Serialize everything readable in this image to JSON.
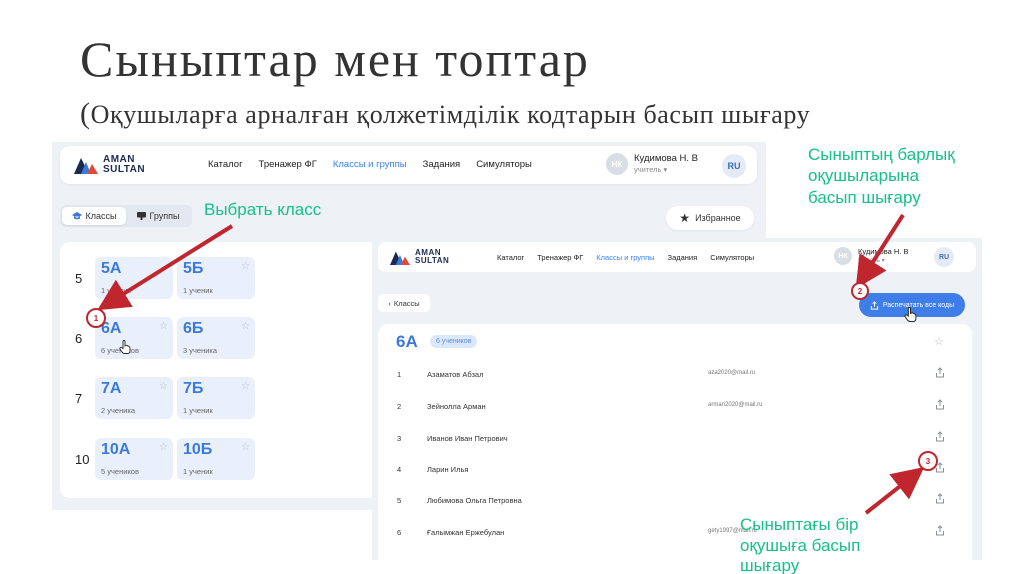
{
  "slide": {
    "title": "Сыныптар мен топтар",
    "subtitle_paren": "(",
    "subtitle_text": "Оқушыларға арналған қолжетімділік кодтарын басып шығару"
  },
  "app": {
    "logo_line1": "AMAN",
    "logo_line2": "SULTAN",
    "nav": [
      "Каталог",
      "Тренажер ФГ",
      "Классы и группы",
      "Задания",
      "Симуляторы"
    ],
    "active_nav_index": 2,
    "user_initials": "НК",
    "user_name": "Кудимова Н. В",
    "user_role": "учитель ▾",
    "lang": "RU"
  },
  "classes_view": {
    "tab_classes": "Классы",
    "tab_groups": "Группы",
    "favorites_label": "Избранное",
    "grades": [
      {
        "grade": "5",
        "classes": [
          {
            "name": "5А",
            "count": "1 ученик"
          },
          {
            "name": "5Б",
            "count": "1 ученик"
          }
        ]
      },
      {
        "grade": "6",
        "classes": [
          {
            "name": "6А",
            "count": "6 учеников"
          },
          {
            "name": "6Б",
            "count": "3 ученика"
          }
        ]
      },
      {
        "grade": "7",
        "classes": [
          {
            "name": "7А",
            "count": "2 ученика"
          },
          {
            "name": "7Б",
            "count": "1 ученик"
          }
        ]
      },
      {
        "grade": "10",
        "classes": [
          {
            "name": "10А",
            "count": "5 учеников"
          },
          {
            "name": "10Б",
            "count": "1 ученик"
          }
        ]
      }
    ]
  },
  "class_detail": {
    "back_label": "Классы",
    "print_all_label": "Распечатать все коды",
    "class_name": "6А",
    "count_badge": "6 учеников",
    "students": [
      {
        "num": "1",
        "name": "Азаматов Абзал",
        "email": "aza2020@mail.ru"
      },
      {
        "num": "2",
        "name": "Зейнолла Арман",
        "email": "arman2020@mail.ru"
      },
      {
        "num": "3",
        "name": "Иванов Иван Петрович",
        "email": ""
      },
      {
        "num": "4",
        "name": "Ларин Илья",
        "email": ""
      },
      {
        "num": "5",
        "name": "Любимова Ольга Петровна",
        "email": ""
      },
      {
        "num": "6",
        "name": "Ғалымжан Ержебулан",
        "email": "gety1997@mail.ru"
      }
    ]
  },
  "annotations": {
    "select_class": "Выбрать класс",
    "print_all_line1": "Сыныптың барлық",
    "print_all_line2": "оқушыларына",
    "print_all_line3": "басып шығару",
    "print_one_line1": "Сыныптағы бір",
    "print_one_line2": "оқушыға басып",
    "print_one_line3": "шығару",
    "marker1": "1",
    "marker2": "2",
    "marker3": "3"
  },
  "colors": {
    "accent_blue": "#3b7ad9",
    "annotation_green": "#15c08a",
    "arrow_red": "#c0262d"
  }
}
